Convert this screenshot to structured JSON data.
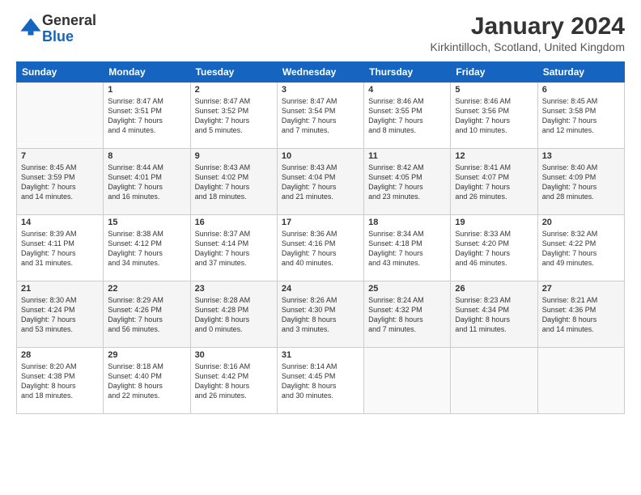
{
  "logo": {
    "general": "General",
    "blue": "Blue"
  },
  "title": "January 2024",
  "location": "Kirkintilloch, Scotland, United Kingdom",
  "days_of_week": [
    "Sunday",
    "Monday",
    "Tuesday",
    "Wednesday",
    "Thursday",
    "Friday",
    "Saturday"
  ],
  "weeks": [
    [
      {
        "num": "",
        "info": ""
      },
      {
        "num": "1",
        "info": "Sunrise: 8:47 AM\nSunset: 3:51 PM\nDaylight: 7 hours\nand 4 minutes."
      },
      {
        "num": "2",
        "info": "Sunrise: 8:47 AM\nSunset: 3:52 PM\nDaylight: 7 hours\nand 5 minutes."
      },
      {
        "num": "3",
        "info": "Sunrise: 8:47 AM\nSunset: 3:54 PM\nDaylight: 7 hours\nand 7 minutes."
      },
      {
        "num": "4",
        "info": "Sunrise: 8:46 AM\nSunset: 3:55 PM\nDaylight: 7 hours\nand 8 minutes."
      },
      {
        "num": "5",
        "info": "Sunrise: 8:46 AM\nSunset: 3:56 PM\nDaylight: 7 hours\nand 10 minutes."
      },
      {
        "num": "6",
        "info": "Sunrise: 8:45 AM\nSunset: 3:58 PM\nDaylight: 7 hours\nand 12 minutes."
      }
    ],
    [
      {
        "num": "7",
        "info": "Sunrise: 8:45 AM\nSunset: 3:59 PM\nDaylight: 7 hours\nand 14 minutes."
      },
      {
        "num": "8",
        "info": "Sunrise: 8:44 AM\nSunset: 4:01 PM\nDaylight: 7 hours\nand 16 minutes."
      },
      {
        "num": "9",
        "info": "Sunrise: 8:43 AM\nSunset: 4:02 PM\nDaylight: 7 hours\nand 18 minutes."
      },
      {
        "num": "10",
        "info": "Sunrise: 8:43 AM\nSunset: 4:04 PM\nDaylight: 7 hours\nand 21 minutes."
      },
      {
        "num": "11",
        "info": "Sunrise: 8:42 AM\nSunset: 4:05 PM\nDaylight: 7 hours\nand 23 minutes."
      },
      {
        "num": "12",
        "info": "Sunrise: 8:41 AM\nSunset: 4:07 PM\nDaylight: 7 hours\nand 26 minutes."
      },
      {
        "num": "13",
        "info": "Sunrise: 8:40 AM\nSunset: 4:09 PM\nDaylight: 7 hours\nand 28 minutes."
      }
    ],
    [
      {
        "num": "14",
        "info": "Sunrise: 8:39 AM\nSunset: 4:11 PM\nDaylight: 7 hours\nand 31 minutes."
      },
      {
        "num": "15",
        "info": "Sunrise: 8:38 AM\nSunset: 4:12 PM\nDaylight: 7 hours\nand 34 minutes."
      },
      {
        "num": "16",
        "info": "Sunrise: 8:37 AM\nSunset: 4:14 PM\nDaylight: 7 hours\nand 37 minutes."
      },
      {
        "num": "17",
        "info": "Sunrise: 8:36 AM\nSunset: 4:16 PM\nDaylight: 7 hours\nand 40 minutes."
      },
      {
        "num": "18",
        "info": "Sunrise: 8:34 AM\nSunset: 4:18 PM\nDaylight: 7 hours\nand 43 minutes."
      },
      {
        "num": "19",
        "info": "Sunrise: 8:33 AM\nSunset: 4:20 PM\nDaylight: 7 hours\nand 46 minutes."
      },
      {
        "num": "20",
        "info": "Sunrise: 8:32 AM\nSunset: 4:22 PM\nDaylight: 7 hours\nand 49 minutes."
      }
    ],
    [
      {
        "num": "21",
        "info": "Sunrise: 8:30 AM\nSunset: 4:24 PM\nDaylight: 7 hours\nand 53 minutes."
      },
      {
        "num": "22",
        "info": "Sunrise: 8:29 AM\nSunset: 4:26 PM\nDaylight: 7 hours\nand 56 minutes."
      },
      {
        "num": "23",
        "info": "Sunrise: 8:28 AM\nSunset: 4:28 PM\nDaylight: 8 hours\nand 0 minutes."
      },
      {
        "num": "24",
        "info": "Sunrise: 8:26 AM\nSunset: 4:30 PM\nDaylight: 8 hours\nand 3 minutes."
      },
      {
        "num": "25",
        "info": "Sunrise: 8:24 AM\nSunset: 4:32 PM\nDaylight: 8 hours\nand 7 minutes."
      },
      {
        "num": "26",
        "info": "Sunrise: 8:23 AM\nSunset: 4:34 PM\nDaylight: 8 hours\nand 11 minutes."
      },
      {
        "num": "27",
        "info": "Sunrise: 8:21 AM\nSunset: 4:36 PM\nDaylight: 8 hours\nand 14 minutes."
      }
    ],
    [
      {
        "num": "28",
        "info": "Sunrise: 8:20 AM\nSunset: 4:38 PM\nDaylight: 8 hours\nand 18 minutes."
      },
      {
        "num": "29",
        "info": "Sunrise: 8:18 AM\nSunset: 4:40 PM\nDaylight: 8 hours\nand 22 minutes."
      },
      {
        "num": "30",
        "info": "Sunrise: 8:16 AM\nSunset: 4:42 PM\nDaylight: 8 hours\nand 26 minutes."
      },
      {
        "num": "31",
        "info": "Sunrise: 8:14 AM\nSunset: 4:45 PM\nDaylight: 8 hours\nand 30 minutes."
      },
      {
        "num": "",
        "info": ""
      },
      {
        "num": "",
        "info": ""
      },
      {
        "num": "",
        "info": ""
      }
    ]
  ]
}
